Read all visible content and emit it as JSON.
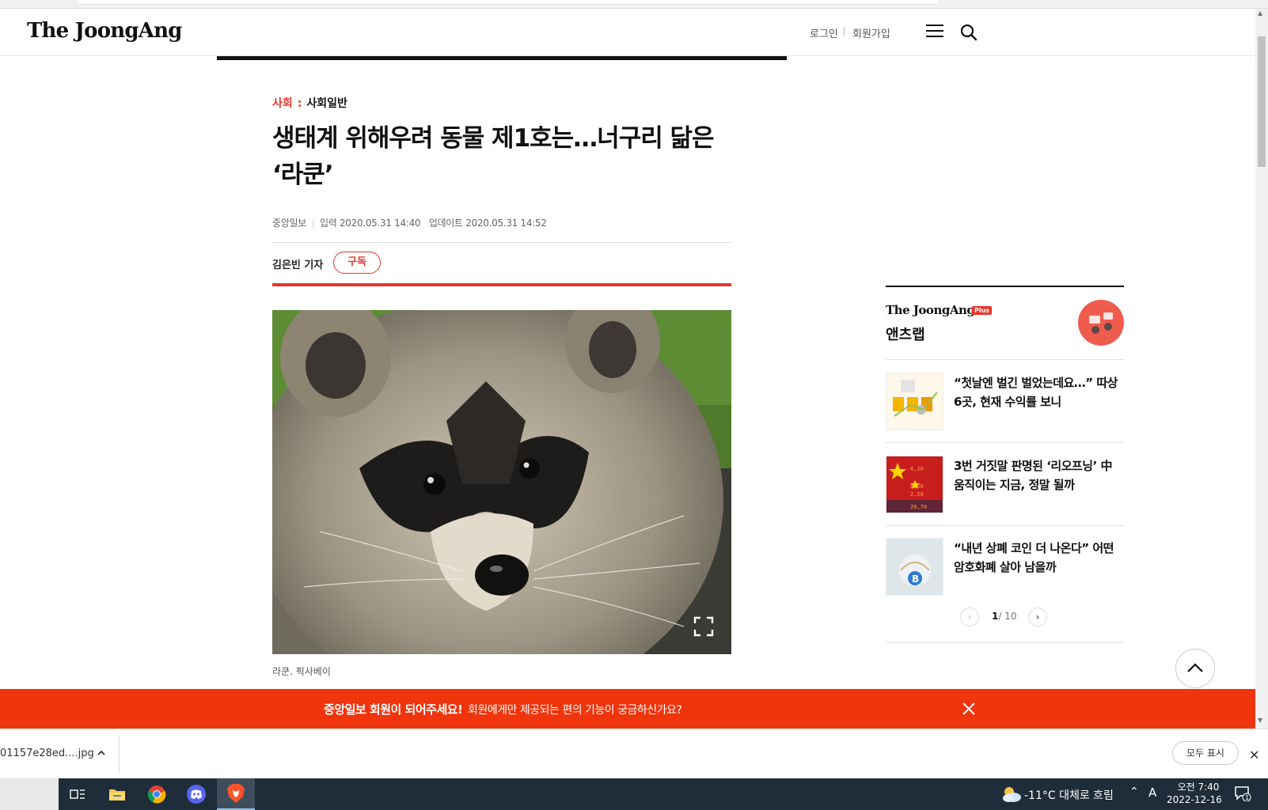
{
  "header": {
    "logo": "The JoongAng",
    "login": "로그인",
    "signup": "회원가입"
  },
  "article": {
    "category_main": "사회",
    "category_sub": "사회일반",
    "headline": "생태계 위해우려 동물 제1호는…너구리 닮은 ‘라쿤’",
    "source": "중앙일보",
    "input_label": "입력 2020.05.31 14:40",
    "update_label": "업데이트 2020.05.31 14:52",
    "reporter": "김은빈 기자",
    "subscribe": "구독",
    "caption": "라쿤. 픽사베이"
  },
  "sidebar": {
    "brand": "The JoongAng",
    "plus": "Plus",
    "title": "앤츠랩",
    "items": [
      {
        "text": "“첫날엔 벌긴 벌었는데요…” 따상 6곳, 현재 수익률 보니"
      },
      {
        "text": "3번 거짓말 판명된 ‘리오프닝’ 中 움직이는 지금, 정말 될까"
      },
      {
        "text": "“내년 상폐 코인 더 나온다” 어떤 암호화폐 살아 남을까"
      }
    ],
    "pager_current": "1",
    "pager_total": "/ 10"
  },
  "banner": {
    "bold": "중앙일보 회원이 되어주세요!",
    "text": "회원에게만 제공되는 편의 기능이 궁금하신가요?"
  },
  "downloads": {
    "file": "01157e28ed....jpg",
    "show_all": "모두 표시"
  },
  "taskbar": {
    "weather": "-11°C  대체로 흐림",
    "ime": "A",
    "time": "오전 7:40",
    "date": "2022-12-16",
    "notif_count": "1"
  },
  "colors": {
    "accent": "#e8352b",
    "banner": "#f0340c",
    "taskbar": "#1f2d3a"
  }
}
